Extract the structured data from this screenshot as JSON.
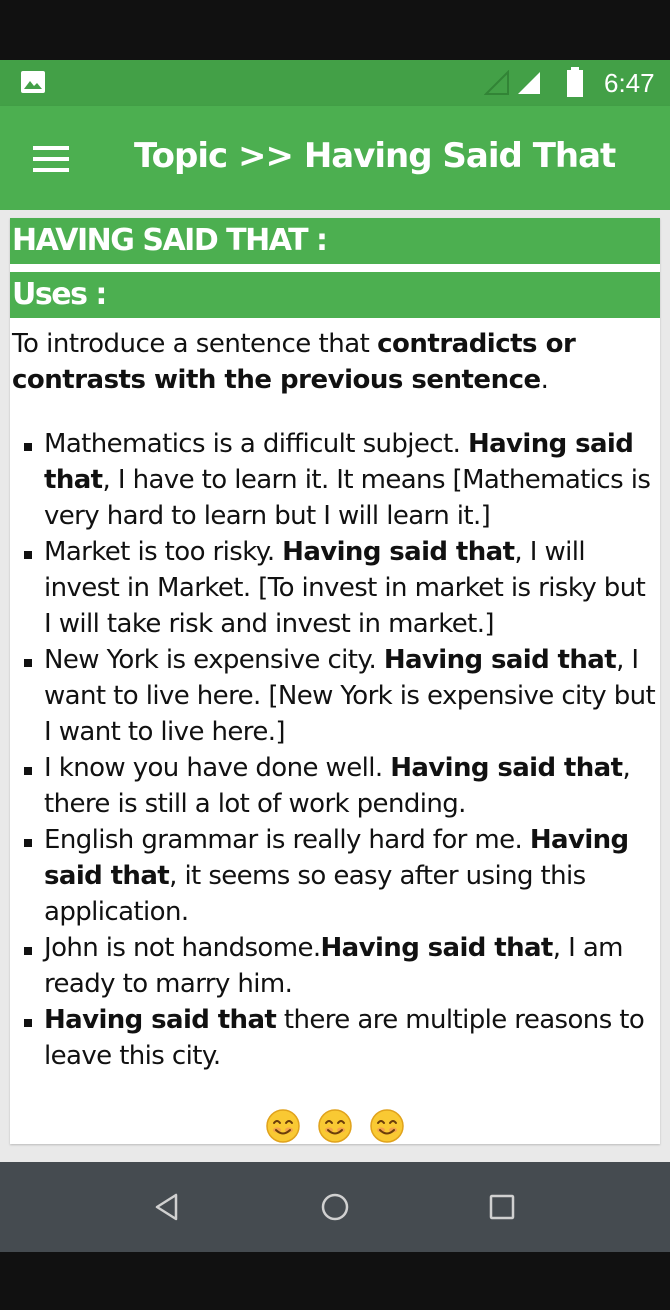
{
  "status_bar": {
    "time": "6:47",
    "icons": [
      "image-icon",
      "wifi-icon",
      "signal-icon",
      "battery-icon"
    ]
  },
  "app_bar": {
    "title": "Topic >> Having Said That",
    "menu_icon": "hamburger-menu-icon"
  },
  "content": {
    "heading": "HAVING SAID THAT :",
    "uses_heading": "Uses :",
    "intro": {
      "prefix": "To introduce a sentence that ",
      "bold": "contradicts or contrasts with the previous sentence",
      "suffix": "."
    },
    "examples": [
      {
        "before": "Mathematics is a difficult subject. ",
        "bold": "Having said that",
        "after": ", I have to learn it. It means [Mathematics is very hard to learn but I will learn it.]"
      },
      {
        "before": "Market is too risky. ",
        "bold": "Having said that",
        "after": ", I will invest in Market. [To invest in market is risky but I will take risk and invest in market.]"
      },
      {
        "before": "New York is expensive city. ",
        "bold": "Having said that",
        "after": ", I want to live here. [New York is expensive city but I want to live here.]"
      },
      {
        "before": "I know you have done well. ",
        "bold": "Having said that",
        "after": ", there is still a lot of work pending."
      },
      {
        "before": "English grammar is really hard for me. ",
        "bold": "Having said that",
        "after": ", it seems so easy after using this application."
      },
      {
        "before": "John is not handsome.",
        "bold": "Having said that",
        "after": ", I am ready to marry him."
      },
      {
        "before": "",
        "bold": "Having said that",
        "after": " there are multiple reasons to leave this city."
      }
    ],
    "smileys": [
      "smiling-face-icon",
      "smiling-face-icon",
      "smiling-face-icon"
    ]
  },
  "nav_bar": {
    "buttons": [
      "back-icon",
      "home-icon",
      "recent-apps-icon"
    ]
  },
  "colors": {
    "status_bar": "#43a047",
    "app_bar": "#4caf50",
    "heading_bar": "#4caf50",
    "nav_bar": "#454b50"
  }
}
